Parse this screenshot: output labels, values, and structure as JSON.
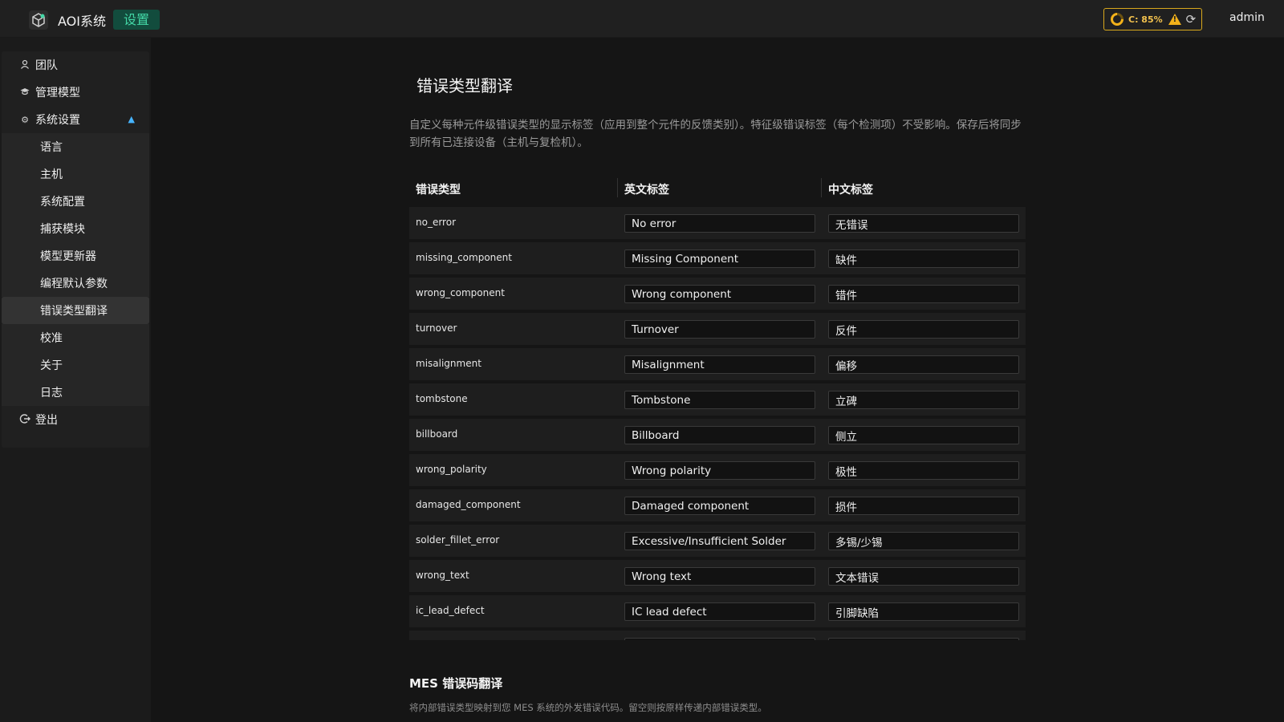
{
  "header": {
    "app_title": "AOI系统",
    "page_badge": "设置",
    "status_text": "C: 85%",
    "user": "admin"
  },
  "sidebar": {
    "items": [
      {
        "label": "团队",
        "icon": "user-icon"
      },
      {
        "label": "管理模型",
        "icon": "graduation-cap-icon"
      },
      {
        "label": "系统设置",
        "icon": "gear-icon"
      }
    ],
    "sub_items": [
      "语言",
      "主机",
      "系统配置",
      "捕获模块",
      "模型更新器",
      "编程默认参数",
      "错误类型翻译",
      "校准",
      "关于",
      "日志"
    ],
    "active_sub_item": "错误类型翻译",
    "logout": "登出"
  },
  "main": {
    "title": "错误类型翻译",
    "description": "自定义每种元件级错误类型的显示标签（应用到整个元件的反馈类别）。特征级错误标签（每个检测项）不受影响。保存后将同步到所有已连接设备（主机与复检机）。",
    "columns": [
      "错误类型",
      "英文标签",
      "中文标签"
    ],
    "rows": [
      {
        "type": "no_error",
        "en": "No error",
        "zh": "无错误"
      },
      {
        "type": "missing_component",
        "en": "Missing Component",
        "zh": "缺件"
      },
      {
        "type": "wrong_component",
        "en": "Wrong component",
        "zh": "错件"
      },
      {
        "type": "turnover",
        "en": "Turnover",
        "zh": "反件"
      },
      {
        "type": "misalignment",
        "en": "Misalignment",
        "zh": "偏移"
      },
      {
        "type": "tombstone",
        "en": "Tombstone",
        "zh": "立碑"
      },
      {
        "type": "billboard",
        "en": "Billboard",
        "zh": "侧立"
      },
      {
        "type": "wrong_polarity",
        "en": "Wrong polarity",
        "zh": "极性"
      },
      {
        "type": "damaged_component",
        "en": "Damaged component",
        "zh": "损件"
      },
      {
        "type": "solder_fillet_error",
        "en": "Excessive/Insufficient Solder",
        "zh": "多锡/少锡"
      },
      {
        "type": "wrong_text",
        "en": "Wrong text",
        "zh": "文本错误"
      },
      {
        "type": "ic_lead_defect",
        "en": "IC lead defect",
        "zh": "引脚缺陷"
      }
    ],
    "mes_title": "MES 错误码翻译",
    "mes_description": "将内部错误类型映射到您 MES 系统的外发错误代码。留空则按原样传递内部错误类型。"
  },
  "colors": {
    "background": "#151515",
    "panel": "#202020",
    "accent_green": "#43d7a6",
    "status_yellow": "#f3b21a",
    "chevron_blue": "#46b4ff"
  }
}
